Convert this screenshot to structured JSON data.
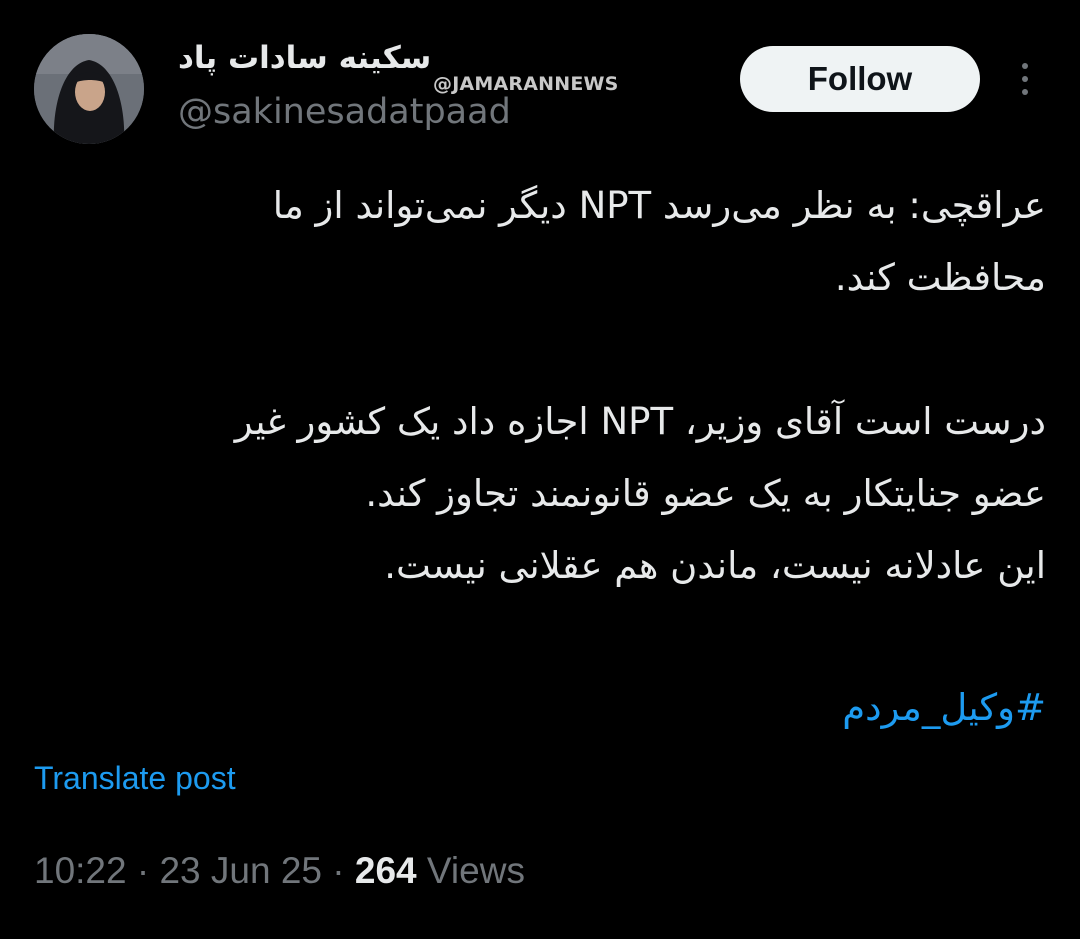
{
  "author": {
    "display_name": "سکینه سادات پاد",
    "handle": "@sakinesadatpaad",
    "avatar_icon": "avatar-photo"
  },
  "watermark": "@JAMARANNEWS",
  "header": {
    "follow_label": "Follow",
    "more_icon": "more-dots-icon"
  },
  "tweet": {
    "paragraphs": [
      [
        "عراقچی: به نظر می‌رسد NPT دیگر نمی‌تواند از ما",
        "محافظت کند."
      ],
      [
        "درست است آقای وزیر، NPT اجازه داد یک کشور غیر",
        "عضو جنایتکار به یک عضو قانونمند تجاوز کند.",
        "این عادلانه نیست، ماندن هم عقلانی نیست."
      ]
    ],
    "hashtag": "#وکیل_مردم"
  },
  "translate_label": "Translate post",
  "meta": {
    "time": "10:22",
    "separator": "·",
    "date": "23 Jun 25",
    "views_count": "264",
    "views_label": "Views"
  },
  "colors": {
    "background": "#000000",
    "primary_text": "#e7e9ea",
    "secondary_text": "#71767b",
    "link": "#1d9bf0",
    "follow_bg": "#eff3f4"
  }
}
